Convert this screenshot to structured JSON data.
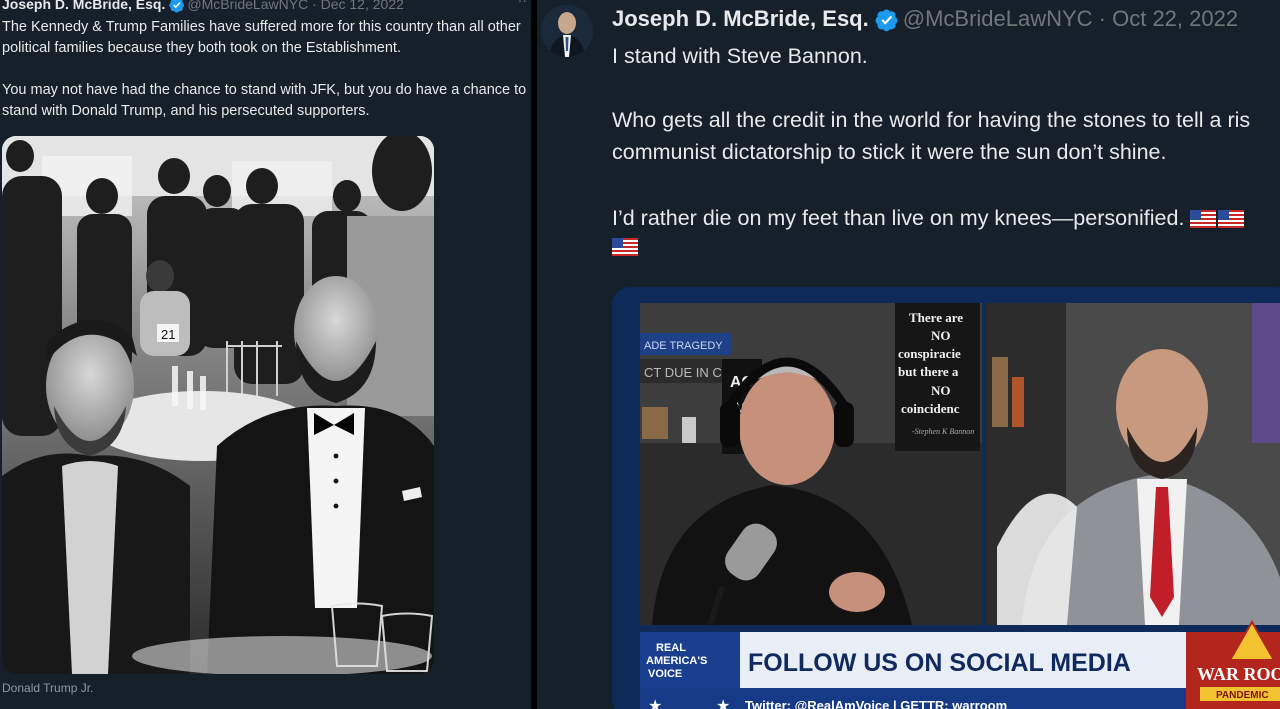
{
  "left_tweet": {
    "author_name": "Joseph D. McBride, Esq.",
    "handle_date": "@McBrideLawNYC · Dec 12, 2022",
    "more": "··",
    "paragraph1": "The Kennedy & Trump Families have suffered more for this country than all other political families because they both took on the Establishment.",
    "paragraph2": "You may not have had the chance to stand with JFK, but you do have a chance to stand with Donald Trump, and his persecuted supporters.",
    "photo": {
      "table_number": "21"
    },
    "caption": "Donald Trump Jr."
  },
  "right_tweet": {
    "author_name": "Joseph D. McBride, Esq.",
    "handle_date": "@McBrideLawNYC · Oct 22, 2022",
    "line1": "I stand with Steve Bannon.",
    "line2": "Who gets all the credit in the world for having the stones to tell a ris",
    "line3": "communist dictatorship to stick it were the sun don’t shine.",
    "line4": "I’d rather die on my feet than live on my knees—personified.",
    "flag_icons": [
      "us-flag-icon",
      "us-flag-icon",
      "us-flag-icon"
    ],
    "video": {
      "back_sign_lines": [
        "There are",
        "NO",
        "conspiracie",
        "but there a",
        "NO",
        "coincidenc",
        "-Stephen K Bannon"
      ],
      "banner_text": "ADE TRAGEDY",
      "banner_text2": "CT DUE IN C",
      "poster_letters": [
        "AC",
        "AC",
        "AC"
      ],
      "network_logo": [
        "REAL",
        "AMERICA'S",
        "VOICE"
      ],
      "ticker_title": "FOLLOW US ON SOCIAL MEDIA",
      "ticker_sub": "Twitter: @RealAmVoice | GETTR: warroom",
      "warroom_logo": "WAR ROO",
      "warroom_sub": "PANDEMIC"
    }
  },
  "colors": {
    "tweet_bg": "#15202b",
    "verified": "#1d9bf0",
    "ticker_blue": "#1a3f8f",
    "warroom_red": "#b3261e"
  }
}
